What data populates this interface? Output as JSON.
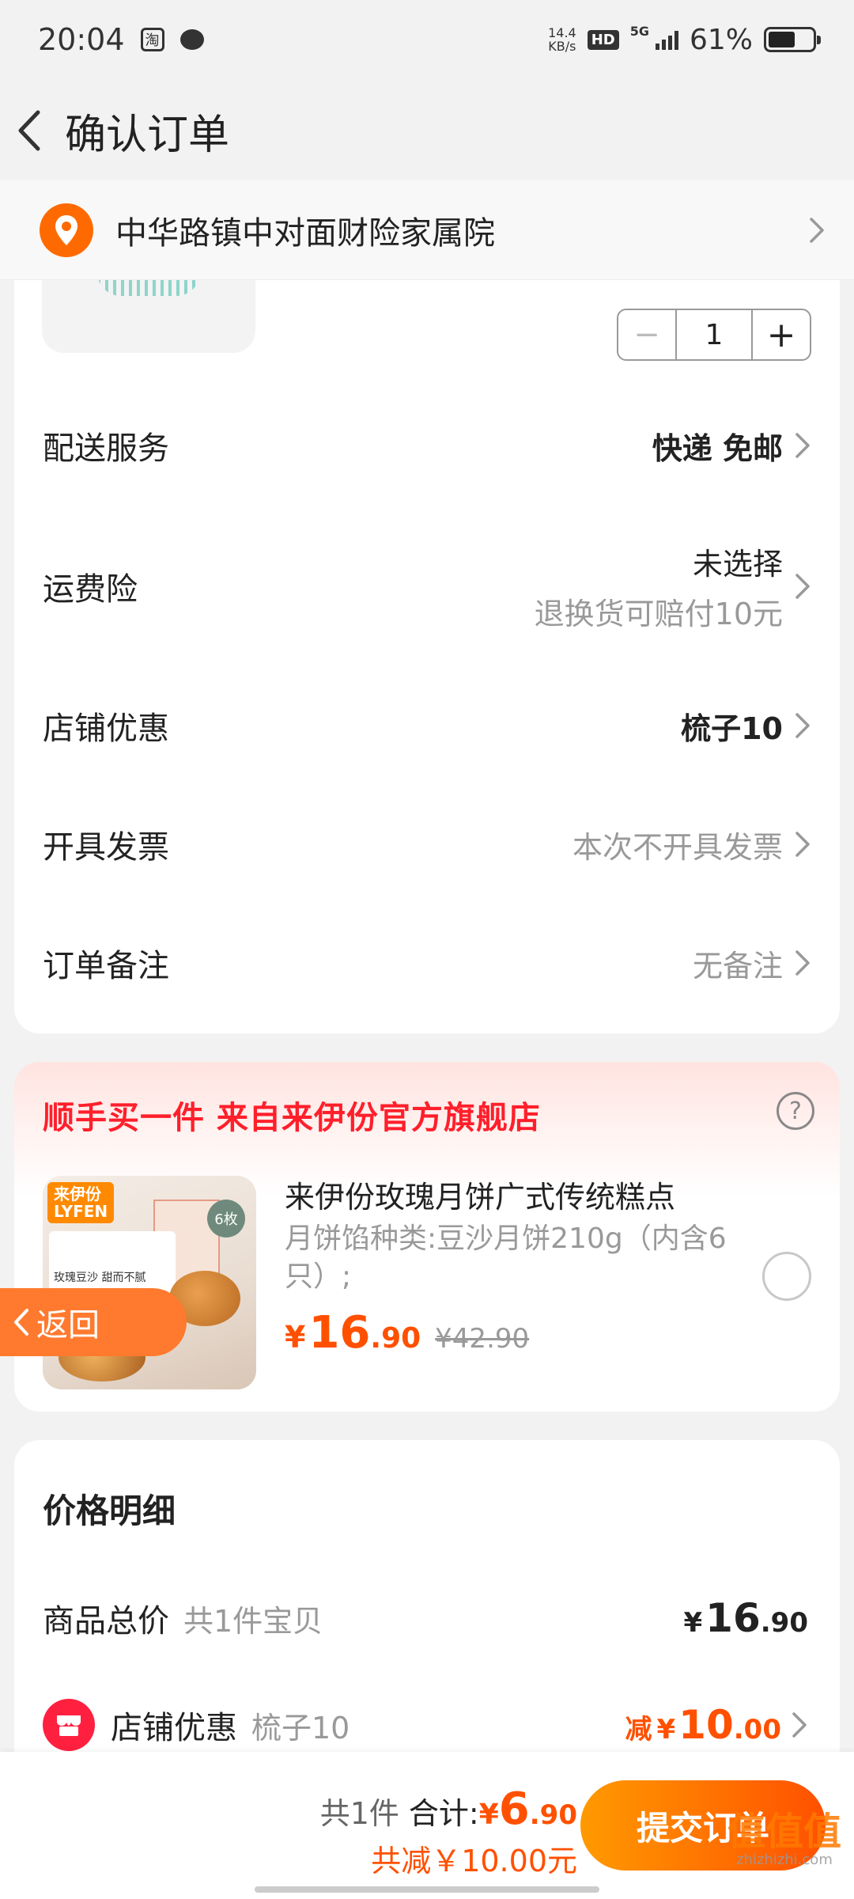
{
  "status_bar": {
    "time": "20:04",
    "app_icon_text": "淘",
    "speed_value": "14.4",
    "speed_unit": "KB/s",
    "hd": "HD",
    "network": "5G",
    "battery": "61%",
    "battery_level": 0.61
  },
  "header": {
    "title": "确认订单",
    "back_icon": "chevron-left-icon"
  },
  "address": {
    "text": "中华路镇中对面财险家属院",
    "icon": "location-pin-icon"
  },
  "product": {
    "quantity": "1",
    "minus": "−",
    "plus": "+"
  },
  "order_rows": [
    {
      "label": "配送服务",
      "value": "快递 免邮"
    },
    {
      "label": "运费险",
      "value": "未选择",
      "sub": "退换货可赔付10元"
    },
    {
      "label": "店铺优惠",
      "value": "梳子10"
    },
    {
      "label": "开具发票",
      "value": "本次不开具发票"
    },
    {
      "label": "订单备注",
      "value": "无备注"
    }
  ],
  "promo": {
    "title": "顺手买一件  来自来伊份官方旗舰店",
    "help": "?",
    "name": "来伊份玫瑰月饼广式传统糕点",
    "spec": "月饼馅种类:豆沙月饼210g（内含6只）;",
    "price_symbol": "¥",
    "price_int": "16",
    "price_dec": ".90",
    "original_price": "¥42.90",
    "image": {
      "brand": "来伊份\nLYFEN",
      "box_text": "玫瑰豆沙 甜而不腻",
      "badge": "6枚"
    }
  },
  "float_back": {
    "label": "返回"
  },
  "price_detail": {
    "title": "价格明细",
    "goods_label": "商品总价",
    "goods_sub": "共1件宝贝",
    "goods_symbol": "¥",
    "goods_int": "16",
    "goods_dec": ".90",
    "shop_label": "店铺优惠",
    "shop_sub": "梳子10",
    "shop_prefix": "减",
    "shop_symbol": "¥",
    "shop_int": "10",
    "shop_dec": ".00"
  },
  "bottom_bar": {
    "count": "共1件",
    "total_label": "合计:",
    "total_symbol": "¥",
    "total_int": "6",
    "total_dec": ".90",
    "discount": "共减￥10.00元",
    "submit": "提交订单"
  },
  "watermark": {
    "text": "值值值",
    "site": "zhizhizhi.com"
  },
  "colors": {
    "accent": "#ff5000",
    "promo_red": "#ff1f2b",
    "location_orange": "#ff6a00",
    "shop_red": "#ff2040"
  }
}
